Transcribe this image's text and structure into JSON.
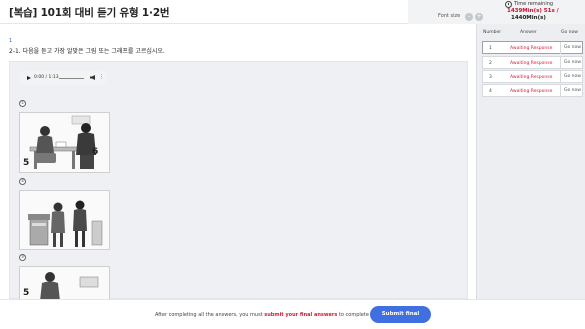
{
  "header": {
    "title": "[복습] 101회 대비 듣기 유형 1·2번",
    "font_size_label": "Font size",
    "font_decrease": "-",
    "font_increase": "+"
  },
  "timer": {
    "label": "Time remaining",
    "remaining": "1439Min(s)  51s /",
    "total": "1440Min(s)"
  },
  "question": {
    "number": "1",
    "prompt": "2-1. 다음을 듣고 가장 알맞은 그림 또는 그래프를 고르십시오.",
    "audio": {
      "time": "0:00 / 1:13"
    },
    "options": [
      {
        "marker": "①",
        "num_left": "5",
        "num_right": "6"
      },
      {
        "marker": "②"
      },
      {
        "marker": "③",
        "num_left": "5"
      }
    ]
  },
  "sidebar": {
    "headers": {
      "number": "Number",
      "answer": "Answer",
      "go": "Go now"
    },
    "rows": [
      {
        "number": "1",
        "status": "Awaiting Response",
        "go": "Go now"
      },
      {
        "number": "2",
        "status": "Awaiting Response",
        "go": "Go now"
      },
      {
        "number": "3",
        "status": "Awaiting Response",
        "go": "Go now"
      },
      {
        "number": "4",
        "status": "Awaiting Response",
        "go": "Go now"
      }
    ]
  },
  "footer": {
    "msg_prefix": "After completing all the answers, you must ",
    "msg_highlight": "submit your final answers",
    "msg_suffix": " to complete the exam.",
    "submit_label": "Submit final answer"
  },
  "colors": {
    "accent": "#3f6fe0",
    "alert": "#d21a3a"
  }
}
